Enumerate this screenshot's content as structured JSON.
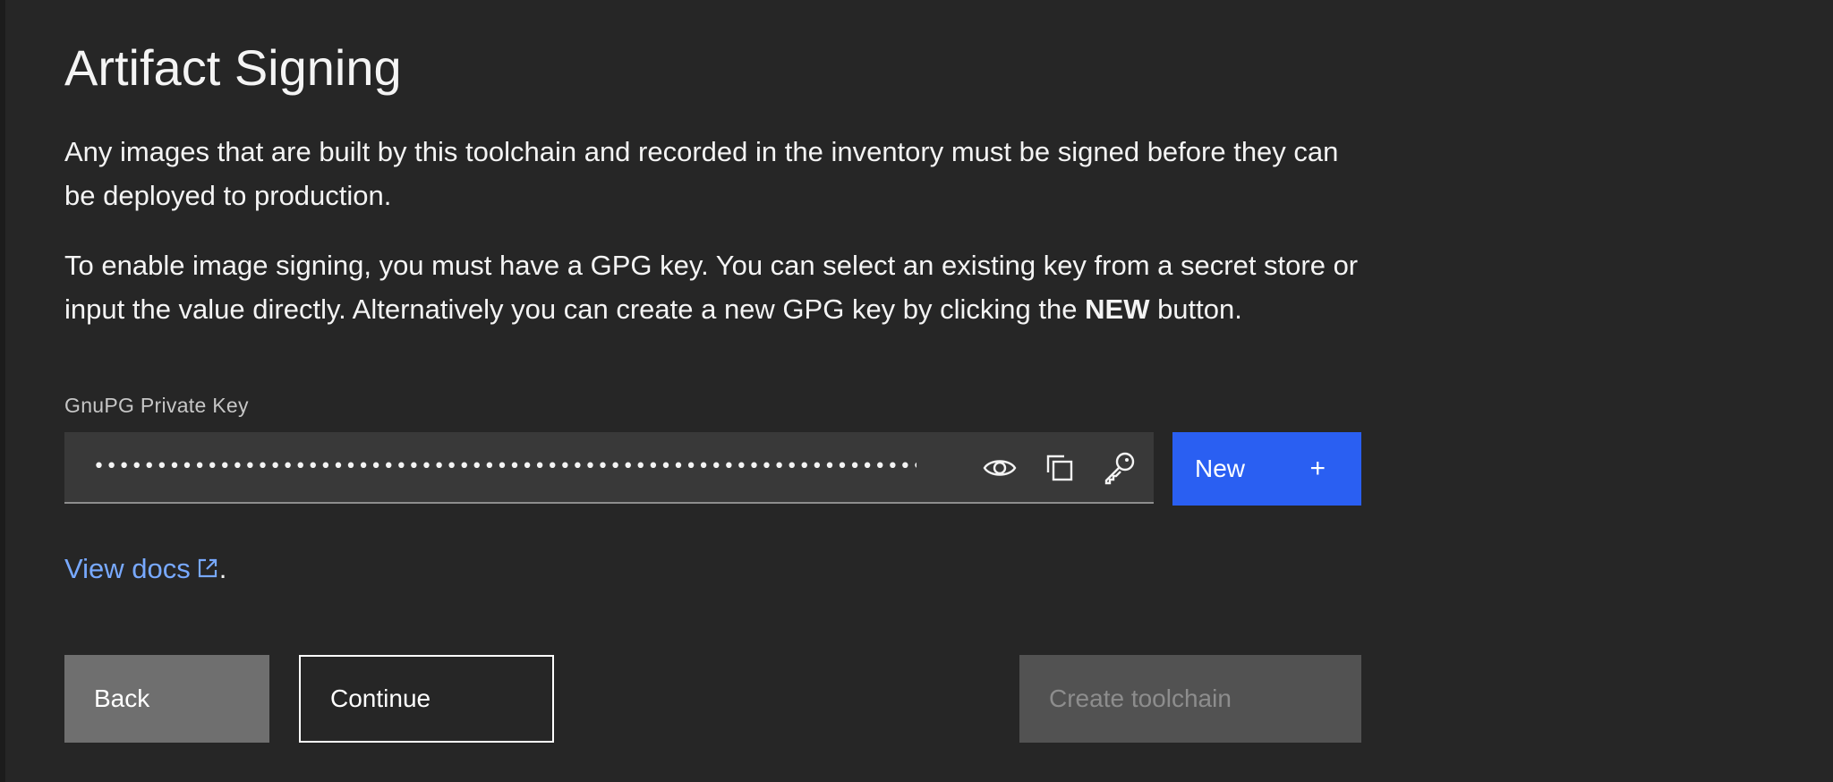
{
  "page": {
    "title": "Artifact Signing",
    "paragraph1": "Any images that are built by this toolchain and recorded in the inventory must be signed before they can be deployed to production.",
    "paragraph2_before": "To enable image signing, you must have a GPG key. You can select an existing key from a secret store or input the value directly. Alternatively you can create a new GPG key by clicking the ",
    "paragraph2_bold": "NEW",
    "paragraph2_after": " button."
  },
  "gpg_field": {
    "label": "GnuPG Private Key",
    "masked_value": "••••••••••••••••••••••••••••••••••••••••••••••••••••••••••••••••••••••••••••••••••••••••",
    "icons": [
      "eye-icon",
      "copy-icon",
      "key-icon"
    ]
  },
  "new_button": {
    "label": "New",
    "icon": "+"
  },
  "docs": {
    "link_text": "View docs",
    "suffix": "."
  },
  "footer": {
    "back_label": "Back",
    "continue_label": "Continue",
    "create_label": "Create toolchain"
  },
  "colors": {
    "background": "#262626",
    "primary_button": "#2a5ff2",
    "link": "#78a9ff",
    "field_background": "#393939",
    "secondary_button": "#6f6f6f",
    "disabled_button": "#525252"
  }
}
